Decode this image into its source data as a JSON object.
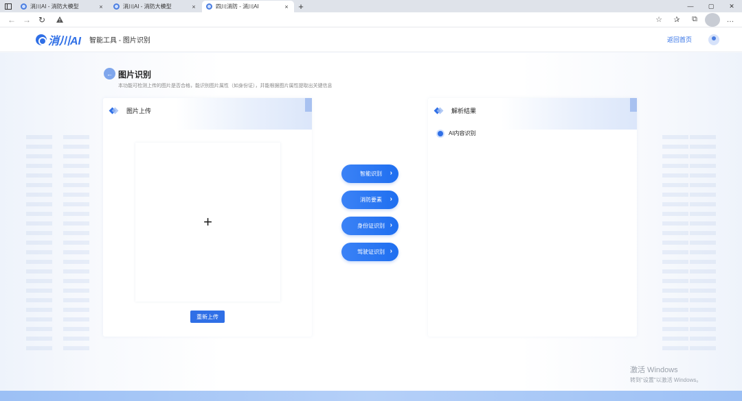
{
  "browser": {
    "tabs": [
      {
        "title": "消川AI - 消防大模型",
        "active": false
      },
      {
        "title": "消川AI - 消防大模型",
        "active": false
      },
      {
        "title": "四川消防 - 消川AI",
        "active": true
      }
    ],
    "new_tab": "+",
    "close_glyph": "×",
    "window_controls": {
      "minimize": "—",
      "maximize": "▢",
      "close": "✕"
    }
  },
  "header": {
    "logo_text": "消川AI",
    "breadcrumb": "智能工具 - 图片识别",
    "home_link": "返回首页"
  },
  "page": {
    "back_icon": "←",
    "title": "图片识别",
    "description": "本功能可检测上传的图片是否合格，能识别图片属性（如身份证），并能根据图片属性提取出关键信息"
  },
  "upload_panel": {
    "title": "图片上传",
    "plus": "+",
    "reupload_label": "重新上传"
  },
  "actions": [
    {
      "label": "智能识别",
      "name": "smart-recognition-button"
    },
    {
      "label": "消防要素",
      "name": "fire-elements-button"
    },
    {
      "label": "身份证识别",
      "name": "id-card-recognition-button"
    },
    {
      "label": "驾驶证识别",
      "name": "driver-license-recognition-button"
    }
  ],
  "chevron": "›",
  "result_panel": {
    "title": "解析结果",
    "item": "AI内容识别"
  },
  "watermark": {
    "line1": "激活 Windows",
    "line2": "转到\"设置\"以激活 Windows。"
  },
  "colors": {
    "accent": "#2f6fe6",
    "button_gradient_start": "#3b82f6",
    "button_gradient_end": "#1f6ff0"
  }
}
